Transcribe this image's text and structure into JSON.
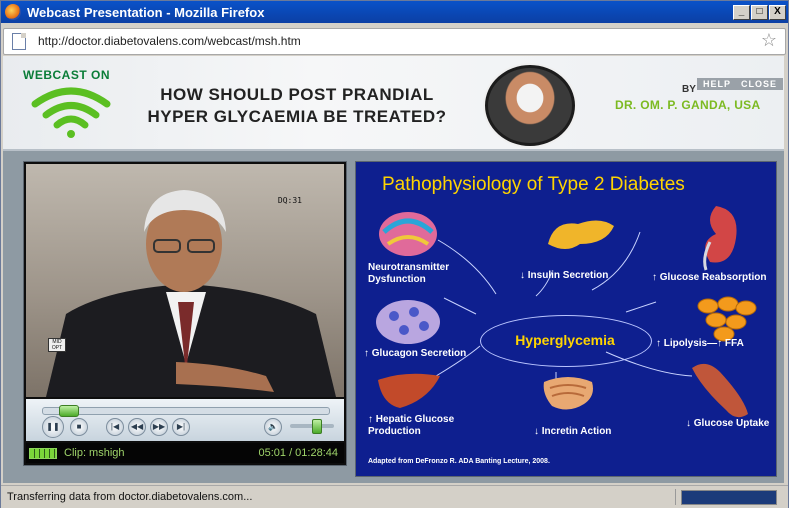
{
  "window": {
    "title": "Webcast Presentation - Mozilla Firefox",
    "controls": {
      "minimize": "_",
      "maximize": "□",
      "close": "X"
    }
  },
  "urlbar": {
    "url": "http://doctor.diabetovalens.com/webcast/msh.htm"
  },
  "header": {
    "webcast_label": "WEBCAST ON",
    "headline_line1": "HOW SHOULD POST PRANDIAL",
    "headline_line2": "HYPER GLYCAEMIA BE TREATED?",
    "by": "BY",
    "speaker": "DR. OM. P. GANDA, USA",
    "help": "HELP",
    "close": "CLOSE"
  },
  "video": {
    "overlay_code": "DQ:31",
    "badge": "MID OPT",
    "clip": "Clip: mshigh",
    "time": "05:01 / 01:28:44",
    "controls": {
      "pause": "❚❚",
      "stop": "■",
      "prev": "|◀",
      "rewind": "◀◀",
      "forward": "▶▶",
      "next": "▶|",
      "volume": "🔈"
    },
    "seek_fraction": 0.057,
    "volume_fraction": 0.6
  },
  "slide": {
    "title": "Pathophysiology of Type 2 Diabetes",
    "center": "Hyperglycemia",
    "labels": {
      "neuro": "Neurotransmitter Dysfunction",
      "insulin": "↓ Insulin Secretion",
      "glucose_reabs": "↑ Glucose Reabsorption",
      "glucagon": "↑ Glucagon Secretion",
      "lipolysis": "↑ Lipolysis—↑ FFA",
      "hepatic": "↑ Hepatic Glucose Production",
      "incretin": "↓ Incretin Action",
      "uptake": "↓ Glucose Uptake"
    },
    "credit": "Adapted from DeFronzo R. ADA Banting Lecture, 2008."
  },
  "statusbar": {
    "text": "Transferring data from doctor.diabetovalens.com..."
  },
  "colors": {
    "title_blue": "#0a52c9",
    "slide_bg": "#0e1f8f",
    "accent_yellow": "#ffd400",
    "speaker_green": "#7cba21"
  }
}
